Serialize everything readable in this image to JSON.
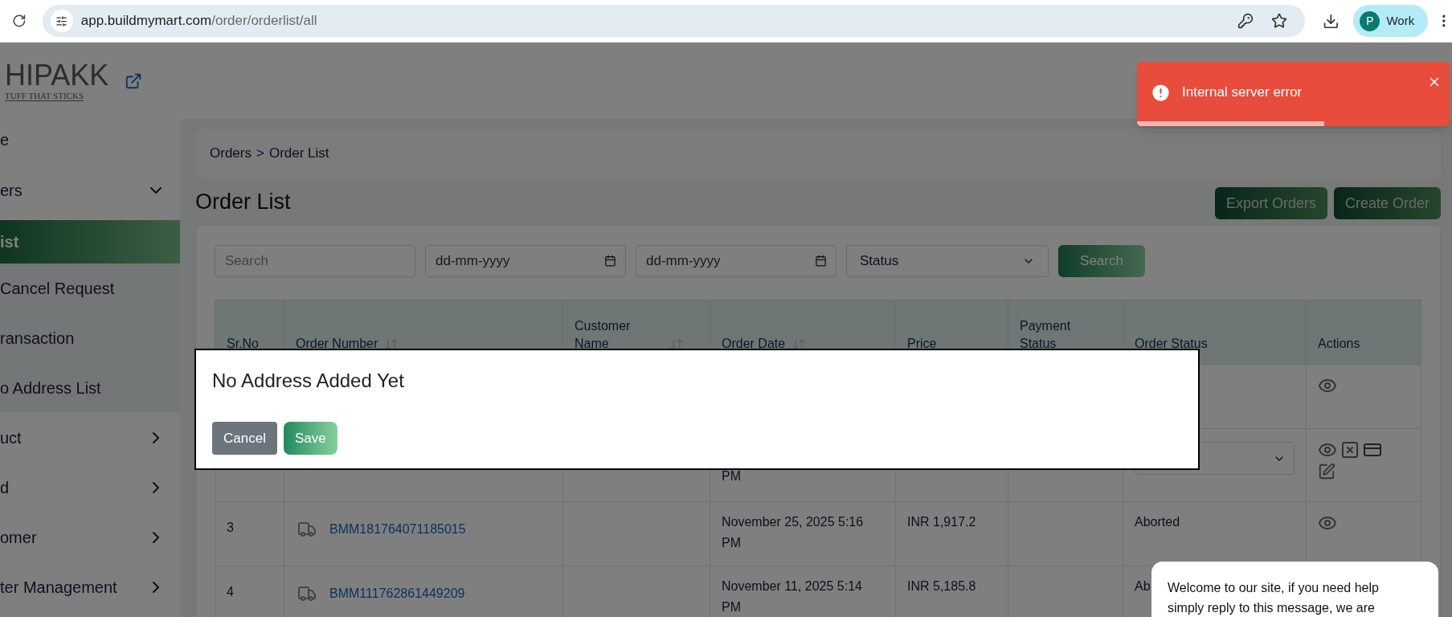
{
  "browser": {
    "url_host": "app.buildmymart.com",
    "url_path": "/order/orderlist/all",
    "profile": {
      "initial": "P",
      "label": "Work"
    }
  },
  "brand": {
    "name": "HIPAKK",
    "tagline": "TUFF THAT STICKS"
  },
  "sidebar": {
    "items": [
      {
        "label": "e",
        "kind": "link"
      },
      {
        "label": "ers",
        "kind": "group",
        "expanded": true,
        "children": [
          {
            "label": "ist",
            "selected": true
          },
          {
            "label": "Cancel Request",
            "selected": false
          },
          {
            "label": "ransaction",
            "selected": false
          },
          {
            "label": "o Address List",
            "selected": false
          }
        ]
      },
      {
        "label": "uct",
        "kind": "group",
        "expanded": false
      },
      {
        "label": "d",
        "kind": "group",
        "expanded": false
      },
      {
        "label": "omer",
        "kind": "group",
        "expanded": false
      },
      {
        "label": "ter Management",
        "kind": "group",
        "expanded": false
      }
    ]
  },
  "breadcrumb": {
    "items": [
      "Orders",
      "Order List"
    ],
    "separator": ">"
  },
  "page_title": "Order List",
  "header_buttons": [
    "Export Orders",
    "Create Order"
  ],
  "filters": {
    "search": {
      "placeholder": "Search"
    },
    "date_from": {
      "placeholder": "dd-mm-yyyy"
    },
    "date_to": {
      "placeholder": "dd-mm-yyyy"
    },
    "status": {
      "label": "Status"
    },
    "button": "Search"
  },
  "table": {
    "columns": [
      {
        "label": "Sr.No",
        "sortable": false
      },
      {
        "label": "Order Number",
        "sortable": true
      },
      {
        "label": "Customer Name",
        "sortable": true
      },
      {
        "label": "Order Date",
        "sortable": true
      },
      {
        "label": "Price",
        "sortable": false
      },
      {
        "label": "Payment Status",
        "sortable": false
      },
      {
        "label": "Order Status",
        "sortable": false
      },
      {
        "label": "Actions",
        "sortable": false
      }
    ],
    "rows": [
      {
        "kind": "closed"
      },
      {
        "kind": "editable",
        "order_date": "PM"
      },
      {
        "kind": "closed",
        "sr": "3",
        "order_number": "BMM181764071185015",
        "order_date": "November 25, 2025 5:16 PM",
        "price": "INR 1,917.2",
        "order_status": "Aborted"
      },
      {
        "kind": "covered",
        "sr": "4",
        "order_number": "BMM111762861449209",
        "order_date": "November 11, 2025 5:14 PM",
        "price": "INR 5,185.8",
        "order_status": "Ab"
      }
    ]
  },
  "dialog": {
    "title": "No Address Added Yet",
    "buttons": [
      {
        "label": "Cancel",
        "kind": "secondary"
      },
      {
        "label": "Save",
        "kind": "primary"
      }
    ]
  },
  "toast": {
    "message": "Internal server error",
    "level": 0.6
  },
  "chat": {
    "message": "Welcome to our site, if you need help simply reply to this message, we are"
  }
}
